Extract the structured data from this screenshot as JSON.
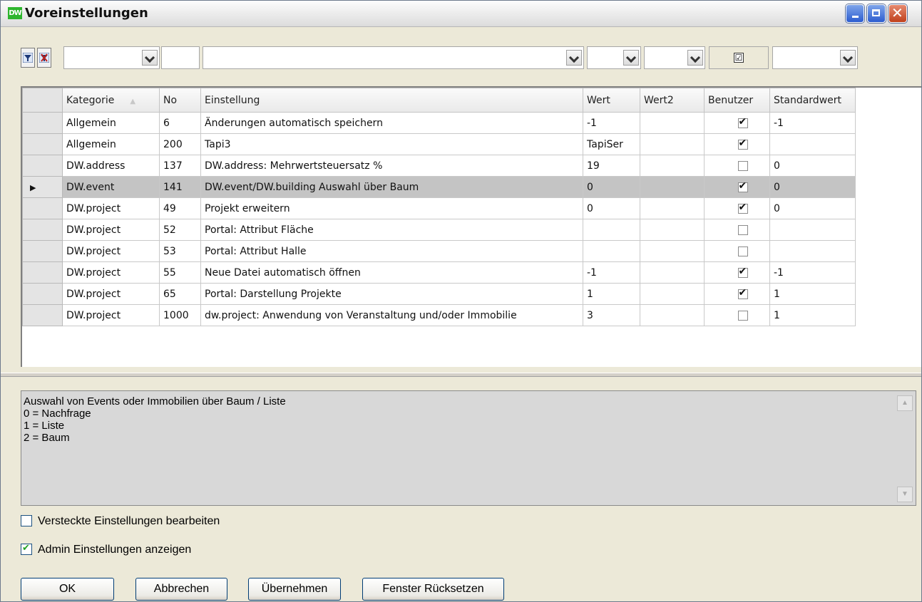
{
  "window": {
    "icon_text": "DW",
    "title": "Voreinstellungen"
  },
  "colors": {
    "title_bg": "#e8e8e8",
    "selected_row": "#c4c4c4",
    "panel_bg": "#ece9d8",
    "desc_bg": "#d8d8d8"
  },
  "filter": {
    "check_symbol": "☑",
    "icons": [
      "filter-icon",
      "clear-filter-icon"
    ]
  },
  "grid": {
    "headers": {
      "kategorie": "Kategorie",
      "no": "No",
      "einstellung": "Einstellung",
      "wert": "Wert",
      "wert2": "Wert2",
      "benutzer": "Benutzer",
      "standardwert": "Standardwert"
    },
    "selected_index": 3,
    "rows": [
      {
        "kategorie": "Allgemein",
        "no": "6",
        "einstellung": "Änderungen automatisch speichern",
        "wert": "-1",
        "wert2": "",
        "benutzer": true,
        "standardwert": "-1"
      },
      {
        "kategorie": "Allgemein",
        "no": "200",
        "einstellung": "Tapi3",
        "wert": "TapiSer",
        "wert2": "",
        "benutzer": true,
        "standardwert": ""
      },
      {
        "kategorie": "DW.address",
        "no": "137",
        "einstellung": "DW.address: Mehrwertsteuersatz %",
        "wert": "19",
        "wert2": "",
        "benutzer": false,
        "standardwert": "0"
      },
      {
        "kategorie": "DW.event",
        "no": "141",
        "einstellung": "DW.event/DW.building Auswahl über Baum",
        "wert": "0",
        "wert2": "",
        "benutzer": true,
        "standardwert": "0"
      },
      {
        "kategorie": "DW.project",
        "no": "49",
        "einstellung": "Projekt erweitern",
        "wert": "0",
        "wert2": "",
        "benutzer": true,
        "standardwert": "0"
      },
      {
        "kategorie": "DW.project",
        "no": "52",
        "einstellung": "Portal: Attribut Fläche",
        "wert": "",
        "wert2": "",
        "benutzer": false,
        "standardwert": ""
      },
      {
        "kategorie": "DW.project",
        "no": "53",
        "einstellung": "Portal: Attribut Halle",
        "wert": "",
        "wert2": "",
        "benutzer": false,
        "standardwert": ""
      },
      {
        "kategorie": "DW.project",
        "no": "55",
        "einstellung": "Neue Datei automatisch öffnen",
        "wert": "-1",
        "wert2": "",
        "benutzer": true,
        "standardwert": "-1"
      },
      {
        "kategorie": "DW.project",
        "no": "65",
        "einstellung": "Portal: Darstellung Projekte",
        "wert": "1",
        "wert2": "",
        "benutzer": true,
        "standardwert": "1"
      },
      {
        "kategorie": "DW.project",
        "no": "1000",
        "einstellung": "dw.project: Anwendung von Veranstaltung und/oder Immobilie",
        "wert": "3",
        "wert2": "",
        "benutzer": false,
        "standardwert": "1"
      }
    ]
  },
  "description": {
    "lines": [
      "Auswahl von Events oder Immobilien über Baum / Liste",
      "0 = Nachfrage",
      "1 = Liste",
      "2 = Baum"
    ]
  },
  "options": {
    "hidden_settings": {
      "label": "Versteckte Einstellungen bearbeiten",
      "checked": false
    },
    "admin_settings": {
      "label": "Admin Einstellungen anzeigen",
      "checked": true
    }
  },
  "buttons": {
    "ok": "OK",
    "cancel": "Abbrechen",
    "apply": "Übernehmen",
    "reset_window": "Fenster Rücksetzen"
  }
}
